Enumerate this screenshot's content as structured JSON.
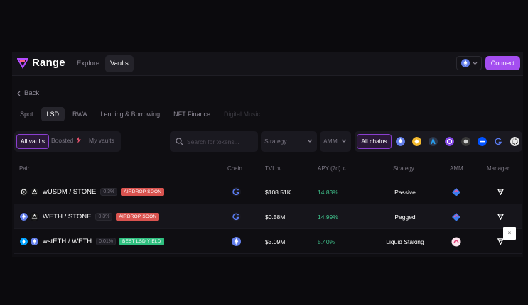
{
  "app": {
    "name": "Range"
  },
  "nav": {
    "explore": "Explore",
    "vaults": "Vaults",
    "connect": "Connect"
  },
  "back_label": "Back",
  "categories": [
    {
      "label": "Spot",
      "active": false
    },
    {
      "label": "LSD",
      "active": true
    },
    {
      "label": "RWA",
      "active": false
    },
    {
      "label": "Lending & Borrowing",
      "active": false
    },
    {
      "label": "NFT Finance",
      "active": false
    },
    {
      "label": "Digital Music",
      "active": false,
      "faded": true
    }
  ],
  "filters": {
    "all_vaults": "All vaults",
    "boosted": "Boosted",
    "my_vaults": "My vaults",
    "search_placeholder": "Search for tokens...",
    "strategy": "Strategy",
    "amm": "AMM",
    "all_chains": "All chains",
    "chains": [
      "ethereum",
      "bnb",
      "arbitrum",
      "polygon",
      "optimism-gray",
      "base",
      "g-chain",
      "mantle"
    ]
  },
  "table": {
    "headers": {
      "pair": "Pair",
      "chain": "Chain",
      "tvl": "TVL",
      "apy": "APY (7d)",
      "strategy": "Strategy",
      "amm": "AMM",
      "manager": "Manager"
    },
    "rows": [
      {
        "pair": "wUSDM / STONE",
        "fee": "0.3%",
        "badge": "AIRDROP SOON",
        "badge_color": "red",
        "tvl": "$108.51K",
        "apy": "14.83%",
        "strategy": "Passive",
        "chain": "g-chain",
        "amm": "uniswap",
        "tokens": [
          "#1a1a1a",
          "#1a1a1a"
        ]
      },
      {
        "pair": "WETH / STONE",
        "fee": "0.3%",
        "badge": "AIRDROP SOON",
        "badge_color": "red",
        "tvl": "$0.58M",
        "apy": "14.99%",
        "strategy": "Pegged",
        "chain": "g-chain",
        "amm": "uniswap",
        "tokens": [
          "#627eea",
          "#1a1a1a"
        ]
      },
      {
        "pair": "wstETH / WETH",
        "fee": "0.01%",
        "badge": "BEST LSD YIELD",
        "badge_color": "green",
        "tvl": "$3.09M",
        "apy": "5.40%",
        "strategy": "Liquid Staking",
        "chain": "ethereum",
        "amm": "pink-amm",
        "tokens": [
          "#00a3ff",
          "#627eea"
        ]
      }
    ]
  },
  "tooltip_close": "×"
}
